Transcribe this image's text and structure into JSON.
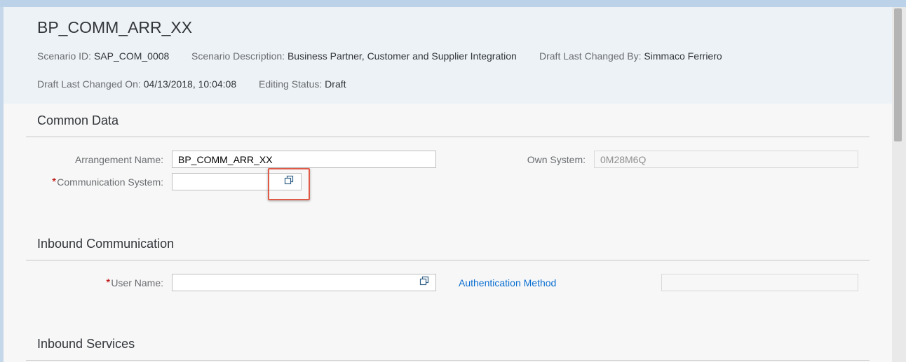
{
  "header": {
    "title": "BP_COMM_ARR_XX",
    "attributes": [
      {
        "label": "Scenario ID",
        "value": "SAP_COM_0008"
      },
      {
        "label": "Scenario Description",
        "value": "Business Partner, Customer and Supplier Integration"
      },
      {
        "label": "Draft Last Changed By",
        "value": "Simmaco Ferriero"
      },
      {
        "label": "Draft Last Changed On",
        "value": "04/13/2018, 10:04:08"
      },
      {
        "label": "Editing Status",
        "value": "Draft"
      }
    ]
  },
  "common_data": {
    "title": "Common Data",
    "arrangement_name_label": "Arrangement Name:",
    "arrangement_name_value": "BP_COMM_ARR_XX",
    "own_system_label": "Own System:",
    "own_system_value": "0M28M6Q",
    "communication_system_label": "Communication System:",
    "communication_system_value": ""
  },
  "inbound_communication": {
    "title": "Inbound Communication",
    "user_name_label": "User Name:",
    "user_name_value": "",
    "authentication_method_link": "Authentication Method",
    "authentication_method_value": ""
  },
  "inbound_services": {
    "title": "Inbound Services"
  },
  "icons": {
    "value_help": "value-help-icon"
  },
  "colors": {
    "header_bg": "#edf2f6",
    "link": "#0a6ed1",
    "required": "#bb0000",
    "highlight": "#e05a48"
  }
}
